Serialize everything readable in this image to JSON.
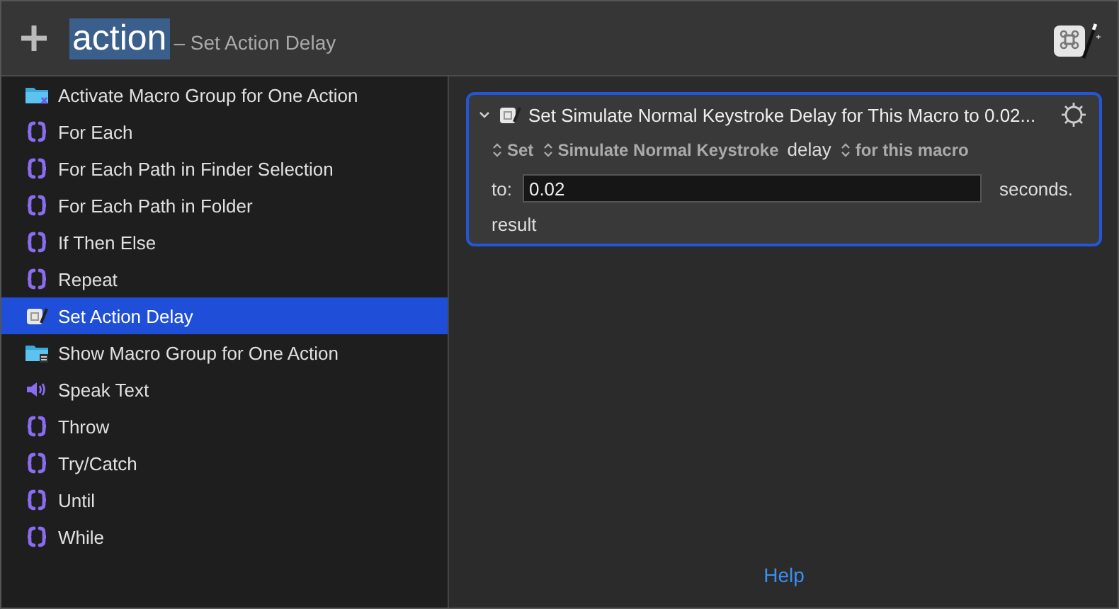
{
  "header": {
    "search_value": "action",
    "completion": "– Set Action Delay"
  },
  "actions": [
    {
      "label": "Activate Macro Group for One Action",
      "kind": "folder-activate",
      "selected": false
    },
    {
      "label": "For Each",
      "kind": "braces",
      "selected": false
    },
    {
      "label": "For Each Path in Finder Selection",
      "kind": "braces",
      "selected": false
    },
    {
      "label": "For Each Path in Folder",
      "kind": "braces",
      "selected": false
    },
    {
      "label": "If Then Else",
      "kind": "braces",
      "selected": false
    },
    {
      "label": "Repeat",
      "kind": "braces",
      "selected": false
    },
    {
      "label": "Set Action Delay",
      "kind": "delay",
      "selected": true
    },
    {
      "label": "Show Macro Group for One Action",
      "kind": "folder-show",
      "selected": false
    },
    {
      "label": "Speak Text",
      "kind": "speaker",
      "selected": false
    },
    {
      "label": "Throw",
      "kind": "braces",
      "selected": false
    },
    {
      "label": "Try/Catch",
      "kind": "braces",
      "selected": false
    },
    {
      "label": "Until",
      "kind": "braces",
      "selected": false
    },
    {
      "label": "While",
      "kind": "braces",
      "selected": false
    }
  ],
  "action_card": {
    "title": "Set Simulate Normal Keystroke Delay for This Macro to 0.02...",
    "expanded": true,
    "parts": [
      {
        "kind": "popup",
        "text": "Set"
      },
      {
        "kind": "popup",
        "text": "Simulate Normal Keystroke"
      },
      {
        "kind": "label",
        "text": "delay"
      },
      {
        "kind": "popup",
        "text": "for this macro"
      }
    ],
    "to_label": "to:",
    "to_value": "0.02",
    "unit": "seconds.",
    "result": "result"
  },
  "help_link": "Help"
}
